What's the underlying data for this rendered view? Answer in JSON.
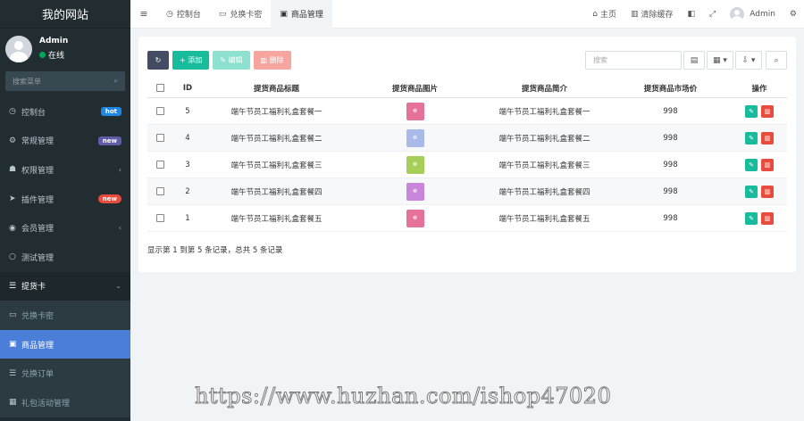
{
  "sidebar": {
    "brand": "我的网站",
    "user": {
      "name": "Admin",
      "status": "在线"
    },
    "search_placeholder": "搜索菜单",
    "items": [
      {
        "icon": "dashboard-icon",
        "glyph": "◷",
        "label": "控制台",
        "badge": "hot"
      },
      {
        "icon": "cogs-icon",
        "glyph": "⚙",
        "label": "常规管理",
        "badge": "new"
      },
      {
        "icon": "group-icon",
        "glyph": "👥",
        "label": "权限管理",
        "chevron": "‹"
      },
      {
        "icon": "rocket-icon",
        "glyph": "➤",
        "label": "插件管理",
        "badge": "new"
      },
      {
        "icon": "user-circle-icon",
        "glyph": "◉",
        "label": "会员管理",
        "chevron": "‹"
      },
      {
        "icon": "circle-icon",
        "glyph": "○",
        "label": "测试管理"
      },
      {
        "icon": "list-icon",
        "glyph": "☰",
        "label": "提货卡",
        "chevron": "⌄"
      },
      {
        "icon": "credit-card-icon",
        "glyph": "▭",
        "label": "兑换卡密"
      },
      {
        "icon": "shopping-bag-icon",
        "glyph": "👜",
        "label": "商品管理"
      },
      {
        "icon": "list-alt-icon",
        "glyph": "☰",
        "label": "兑换订单"
      },
      {
        "icon": "grid-icon",
        "glyph": "▦",
        "label": "礼包活动管理"
      }
    ]
  },
  "topbar": {
    "toggle_glyph": "≡",
    "tabs": [
      {
        "icon": "dashboard-icon",
        "glyph": "◷",
        "label": "控制台"
      },
      {
        "icon": "credit-card-icon",
        "glyph": "▭",
        "label": "兑换卡密"
      },
      {
        "icon": "shopping-bag-icon",
        "glyph": "👜",
        "label": "商品管理"
      }
    ],
    "home": "主页",
    "clear_cache": "清除缓存",
    "user": "Admin"
  },
  "toolbar": {
    "add_label": "添加",
    "edit_label": "编辑",
    "delete_label": "删除",
    "search_placeholder": "搜索"
  },
  "table": {
    "headers": [
      "ID",
      "提货商品标题",
      "提货商品图片",
      "提货商品简介",
      "提货商品市场价",
      "操作"
    ],
    "rows": [
      {
        "id": "5",
        "title": "端午节员工福利礼盒套餐一",
        "img_color": "#e6729a",
        "desc": "端午节员工福利礼盒套餐一",
        "price": "998"
      },
      {
        "id": "4",
        "title": "端午节员工福利礼盒套餐二",
        "img_color": "#a9b9e8",
        "desc": "端午节员工福利礼盒套餐二",
        "price": "998"
      },
      {
        "id": "3",
        "title": "端午节员工福利礼盒套餐三",
        "img_color": "#a6cf5a",
        "desc": "端午节员工福利礼盒套餐三",
        "price": "998"
      },
      {
        "id": "2",
        "title": "端午节员工福利礼盒套餐四",
        "img_color": "#c986da",
        "desc": "端午节员工福利礼盒套餐四",
        "price": "998"
      },
      {
        "id": "1",
        "title": "端午节员工福利礼盒套餐五",
        "img_color": "#e6729a",
        "desc": "端午节员工福利礼盒套餐五",
        "price": "998"
      }
    ]
  },
  "pagination_text": "显示第 1 到第 5 条记录，总共 5 条记录",
  "watermark": "https://www.huzhan.com/ishop47020"
}
